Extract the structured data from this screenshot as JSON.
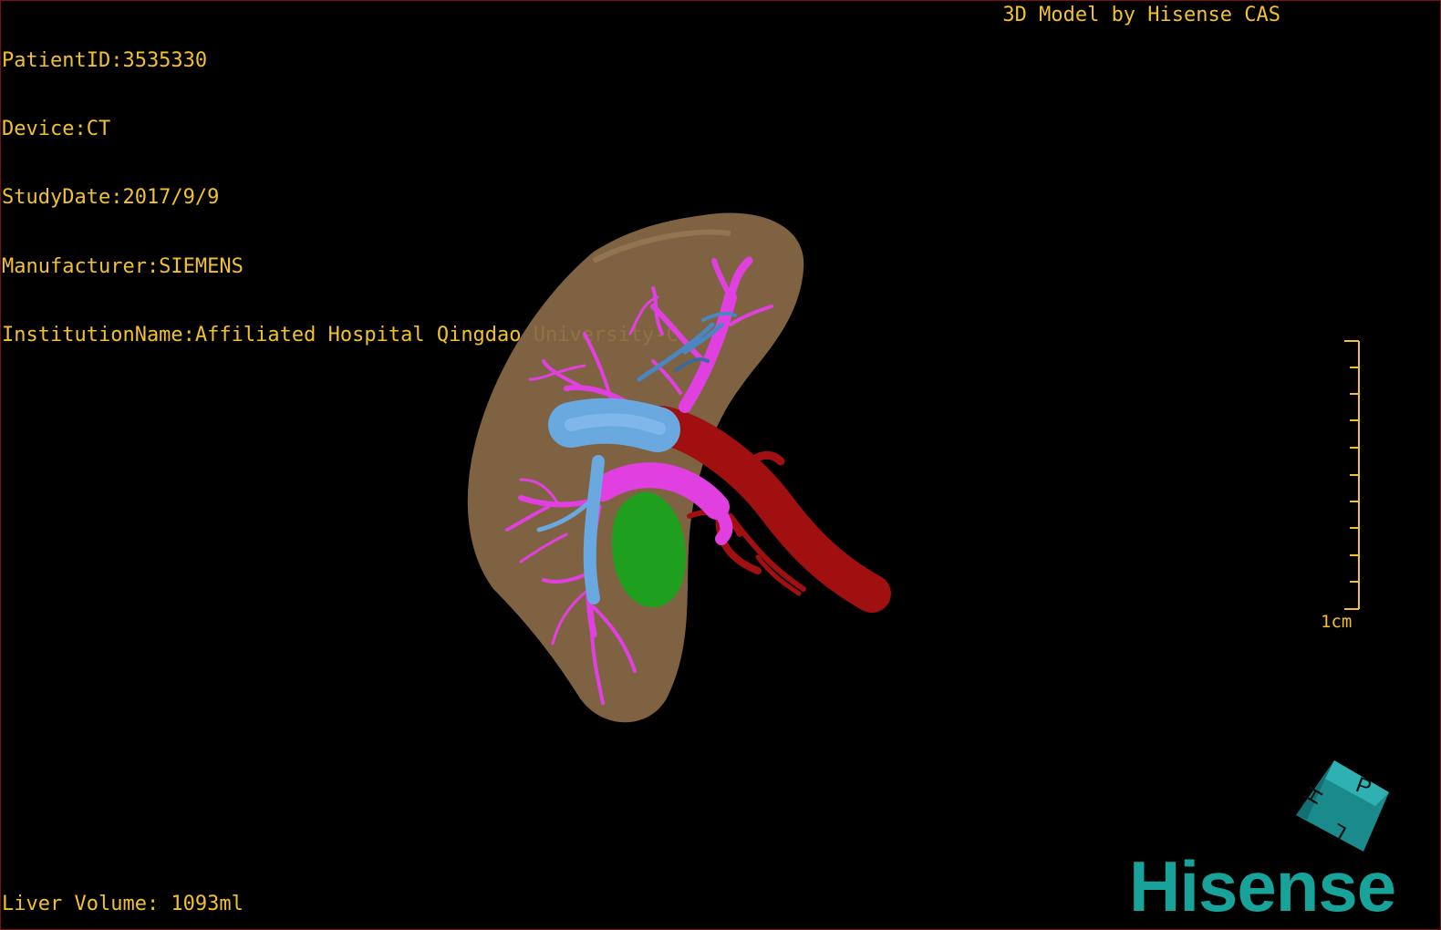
{
  "info": {
    "patient_id": "PatientID:3535330",
    "device": "Device:CT",
    "study_date": "StudyDate:2017/9/9",
    "manufacturer": "Manufacturer:SIEMENS",
    "institution": "InstitutionName:Affiliated Hospital Qingdao University-C"
  },
  "credit": "3D Model by Hisense CAS",
  "scale": {
    "label": "1cm"
  },
  "volume": "Liver Volume: 1093ml",
  "brand": {
    "logo_text": "Hisense"
  },
  "colors": {
    "overlay_text": "#f2c12e",
    "border": "#7a1010",
    "liver": "#8a6a48",
    "portal_vein": "#e040e0",
    "hepatic_vein": "#6aa8e0",
    "artery": "#a01010",
    "gallbladder": "#1ea01e",
    "brand": "#18a39a"
  },
  "orientation_cube": {
    "face_letters": [
      "P",
      "H",
      "L"
    ],
    "icon": "orientation-cube-icon"
  }
}
